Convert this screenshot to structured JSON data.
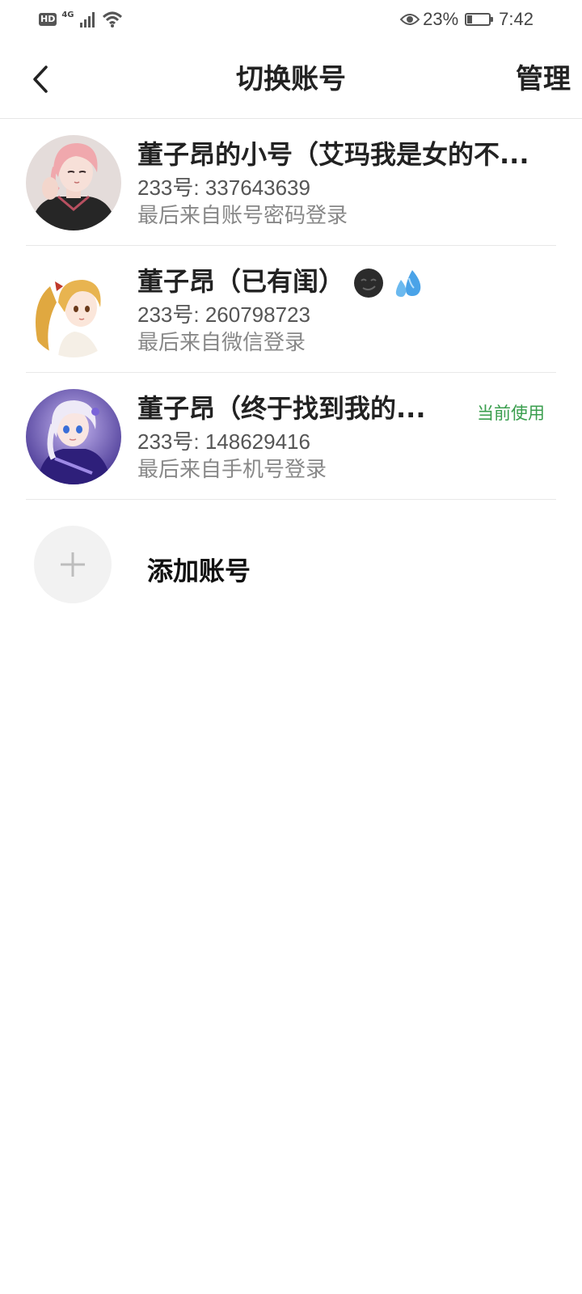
{
  "status_bar": {
    "hd": "HD",
    "network": "4G",
    "battery_percent": "23%",
    "battery_level": 0.23,
    "time": "7:42"
  },
  "header": {
    "title": "切换账号",
    "manage_label": "管理"
  },
  "accounts": [
    {
      "name": "董子昂的小号（艾玛我是女的不...",
      "id_text": "233号: 337643639",
      "login_text": "最后来自账号密码登录",
      "avatar_icon": "pink-hair-boy-avatar",
      "current_label": ""
    },
    {
      "name": "董子昂（已有闺）",
      "id_text": "233号: 260798723",
      "login_text": "最后来自微信登录",
      "avatar_icon": "blonde-ponytail-girl-avatar",
      "current_label": ""
    },
    {
      "name": "董子昂（终于找到我的...",
      "id_text": "233号: 148629416",
      "login_text": "最后来自手机号登录",
      "avatar_icon": "white-hair-purple-girl-avatar",
      "current_label": "当前使用"
    }
  ],
  "add_account": {
    "label": "添加账号"
  }
}
